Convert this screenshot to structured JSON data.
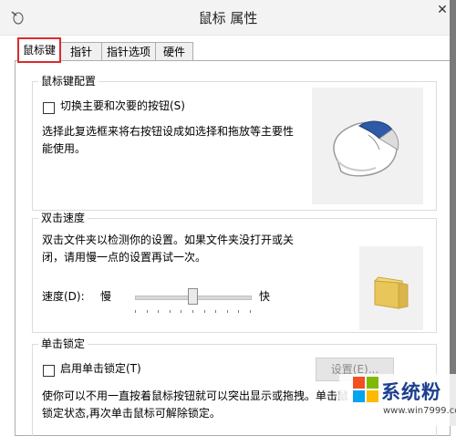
{
  "window": {
    "title": "鼠标 属性",
    "close_glyph": "✕"
  },
  "tabs": [
    {
      "label": "鼠标键",
      "active": true
    },
    {
      "label": "指针",
      "active": false
    },
    {
      "label": "指针选项",
      "active": false
    },
    {
      "label": "硬件",
      "active": false
    }
  ],
  "button_config": {
    "title": "鼠标键配置",
    "swap_checkbox_label": "切换主要和次要的按钮(S)",
    "swap_checked": false,
    "description_line1": "选择此复选框来将右按钮设成如选择和拖放等主要性",
    "description_line2": "能使用。",
    "preview_icon": "mouse-icon"
  },
  "double_click": {
    "title": "双击速度",
    "description_line1": "双击文件夹以检测你的设置。如果文件夹没打开或关",
    "description_line2": "闭，请用慢一点的设置再试一次。",
    "speed_label": "速度(D):",
    "slow_label": "慢",
    "fast_label": "快",
    "speed_value": 0.5,
    "test_icon": "folder-icon"
  },
  "click_lock": {
    "title": "单击锁定",
    "checkbox_label": "启用单击锁定(T)",
    "checked": false,
    "settings_button": "设置(E)...",
    "description_line1": "使你可以不用一直按着鼠标按钮就可以突出显示或拖拽。单击鼠",
    "description_line2": "锁定状态,再次单击鼠标可解除锁定。"
  },
  "watermark": {
    "name": "系统粉",
    "url": "www.win7999.com"
  },
  "colors": {
    "active_tab_outline": "#d62d2d",
    "watermark_text": "#1c3f8f"
  }
}
